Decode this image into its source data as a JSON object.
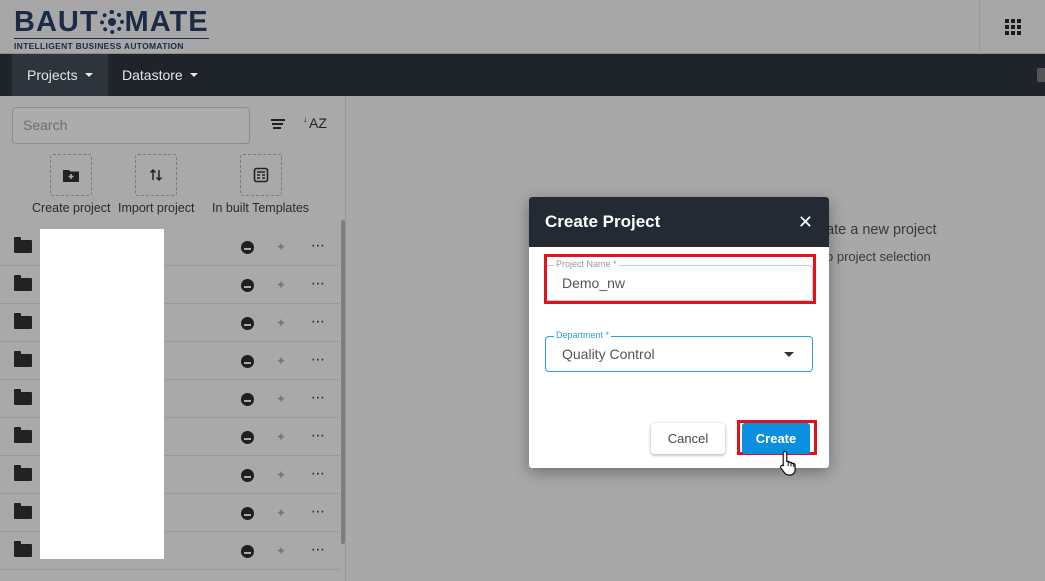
{
  "header": {
    "logo_main_before": "BAUT",
    "logo_main_after": "MATE",
    "logo_sub": "INTELLIGENT BUSINESS AUTOMATION",
    "apps_icon": "apps-grid-icon"
  },
  "navbar": {
    "items": [
      {
        "label": "Projects",
        "active": true
      },
      {
        "label": "Datastore",
        "active": false
      }
    ]
  },
  "sidebar": {
    "search_placeholder": "Search",
    "actions": [
      {
        "label": "Create project",
        "icon": "folder-plus-icon"
      },
      {
        "label": "Import project",
        "icon": "import-arrows-icon"
      },
      {
        "label": "In built Templates",
        "icon": "template-icon"
      }
    ],
    "rows": [
      {
        "name": ""
      },
      {
        "name": ""
      },
      {
        "name": ""
      },
      {
        "name": ""
      },
      {
        "name": ""
      },
      {
        "name": ""
      },
      {
        "name": ""
      },
      {
        "name": ""
      },
      {
        "name": ""
      }
    ]
  },
  "main": {
    "hint_line1": "eate a new project",
    "hint_line2": "o project selection"
  },
  "modal": {
    "title": "Create Project",
    "project_name": {
      "label": "Project Name *",
      "value": "Demo_nw"
    },
    "department": {
      "label": "Department *",
      "value": "Quality Control"
    },
    "cancel_label": "Cancel",
    "create_label": "Create"
  },
  "colors": {
    "navbar": "#1f242b",
    "accent": "#0d8fe0",
    "highlight": "#e0121b"
  }
}
